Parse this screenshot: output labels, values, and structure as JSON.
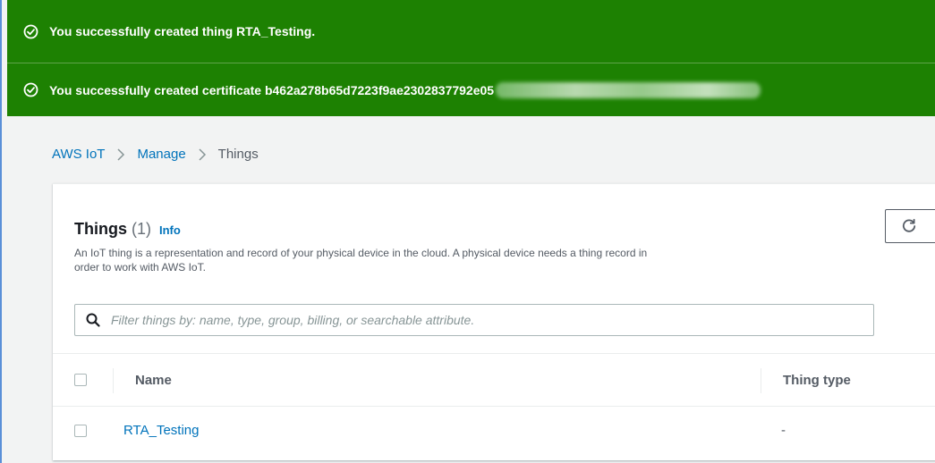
{
  "notifications": [
    {
      "message": "You successfully created thing RTA_Testing."
    },
    {
      "message": "You successfully created certificate b462a278b65d7223f9ae2302837792e05"
    }
  ],
  "breadcrumb": {
    "items": [
      "AWS IoT",
      "Manage",
      "Things"
    ]
  },
  "panel": {
    "title": "Things",
    "count": "(1)",
    "info_label": "Info",
    "description": "An IoT thing is a representation and record of your physical device in the cloud. A physical device needs a thing record in order to work with AWS IoT."
  },
  "search": {
    "placeholder": "Filter things by: name, type, group, billing, or searchable attribute."
  },
  "table": {
    "columns": [
      "Name",
      "Thing type"
    ],
    "rows": [
      {
        "name": "RTA_Testing",
        "thing_type": "-"
      }
    ]
  },
  "colors": {
    "success": "#1d8102",
    "link": "#0073bb"
  }
}
